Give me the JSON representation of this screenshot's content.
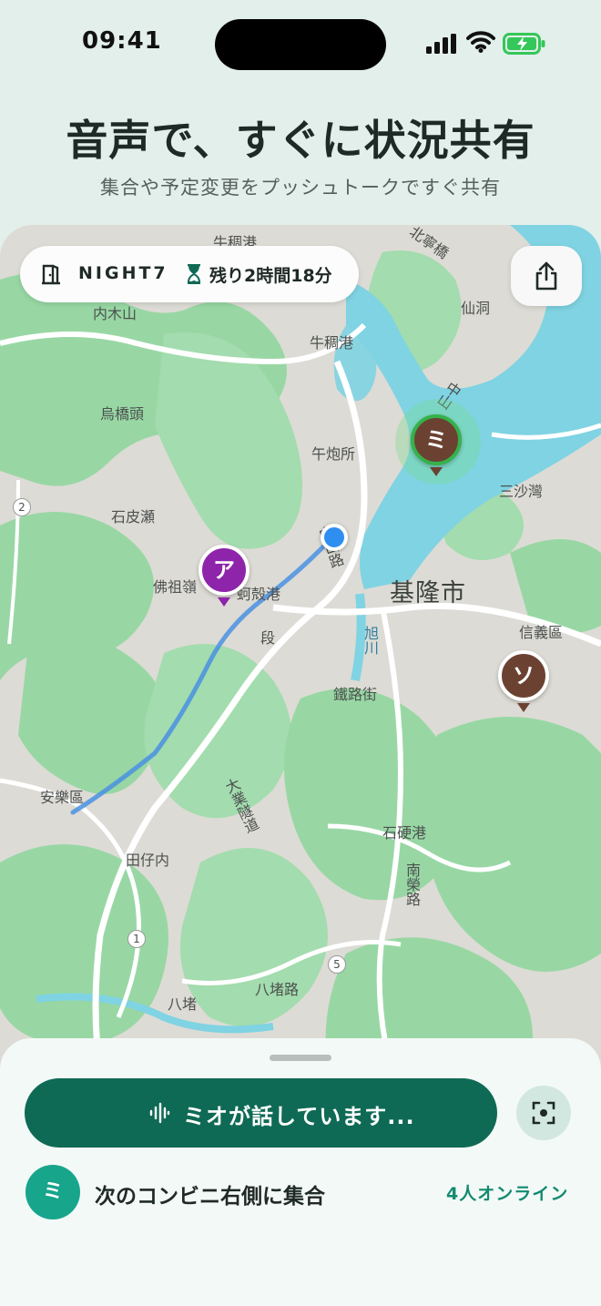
{
  "status_bar": {
    "time": "09:41"
  },
  "header": {
    "title": "音声で、すぐに状況共有",
    "subtitle": "集合や予定変更をプッシュトークですぐ共有"
  },
  "session": {
    "code": "NIGHT7",
    "remaining": "残り2時間18分"
  },
  "map": {
    "labels": {
      "city": "基隆市",
      "mutoushan": "内木山",
      "wuqiaotou": "烏橋頭",
      "wupaosuo": "午炮所",
      "niuchougang": "牛稠港",
      "niuchougang_top": "牛稠港",
      "xiandong": "仙洞",
      "shipilai": "石皮瀬",
      "fozuling": "佛祖嶺",
      "eqiaogang": "蚵殻港",
      "sanshawan": "三沙灣",
      "xinyiqu": "信義區",
      "tieluje": "鐵路街",
      "anlequ": "安樂區",
      "tianzinei": "田仔内",
      "shiyinggang": "石硬港",
      "badu": "八堵",
      "baduroad": "八堵路",
      "xuchuan": "旭川",
      "duan": "段",
      "zhongzheng": "中",
      "nanrong": "南榮路",
      "dazhong": "大業隧道",
      "beining": "北寧橋",
      "zhong1": "中山",
      "road2": "路",
      "zhongshan_vert": "中山路",
      "rt2": "2",
      "rt1": "1",
      "rt5": "5"
    }
  },
  "pins": [
    {
      "label": "ミ",
      "color": "#6b4232",
      "ring": "#35b24a"
    },
    {
      "label": "ア",
      "color": "#8e24aa"
    },
    {
      "label": "ソ",
      "color": "#6b4232"
    }
  ],
  "sheet": {
    "talk_label": "ミオが話しています...",
    "avatar_letter": "ミ",
    "message": "次のコンビニ右側に集合",
    "online": "4人オンライン"
  },
  "colors": {
    "accent": "#0f6a55",
    "water": "#7fd3e2",
    "park": "#8fd39b",
    "land": "#dcdad4"
  },
  "icons": [
    "signal-icon",
    "wifi-icon",
    "battery-icon",
    "door-icon",
    "hourglass-icon",
    "share-icon",
    "waveform-icon",
    "scan-icon"
  ]
}
